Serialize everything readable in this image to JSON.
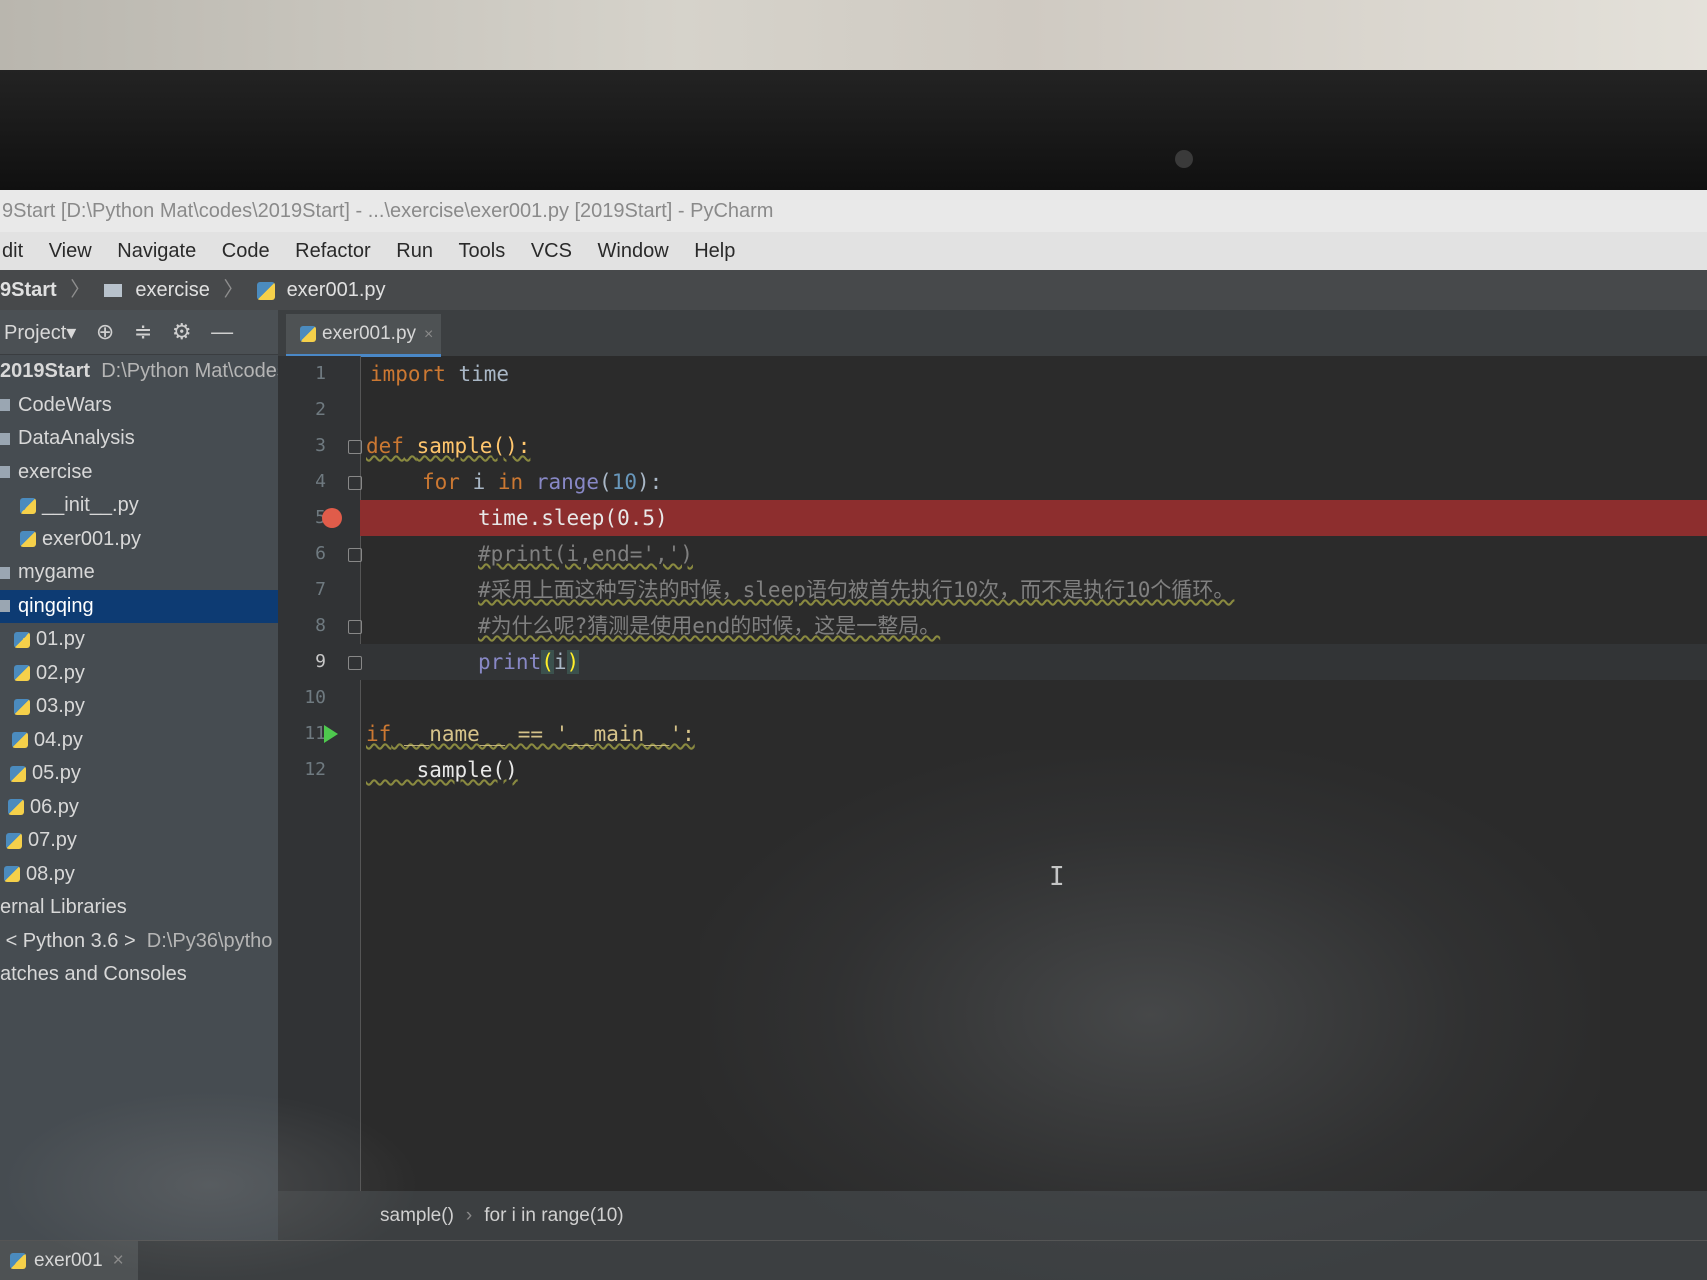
{
  "window": {
    "title": "9Start [D:\\Python Mat\\codes\\2019Start] - ...\\exercise\\exer001.py [2019Start] - PyCharm"
  },
  "menu": [
    "dit",
    "View",
    "Navigate",
    "Code",
    "Refactor",
    "Run",
    "Tools",
    "VCS",
    "Window",
    "Help"
  ],
  "navbar": {
    "project": "9Start",
    "folder": "exercise",
    "file": "exer001.py"
  },
  "project_panel": {
    "header": "Project▾",
    "items": [
      {
        "label": "2019Start",
        "extra": "D:\\Python Mat\\codes",
        "type": "root"
      },
      {
        "label": "CodeWars",
        "type": "folder"
      },
      {
        "label": "DataAnalysis",
        "type": "folder"
      },
      {
        "label": "exercise",
        "type": "folder"
      },
      {
        "label": "__init__.py",
        "type": "file"
      },
      {
        "label": "exer001.py",
        "type": "file"
      },
      {
        "label": "mygame",
        "type": "folder"
      },
      {
        "label": "qingqing",
        "type": "folder",
        "selected": true
      },
      {
        "label": "01.py",
        "type": "file"
      },
      {
        "label": "02.py",
        "type": "file"
      },
      {
        "label": "03.py",
        "type": "file"
      },
      {
        "label": "04.py",
        "type": "file"
      },
      {
        "label": "05.py",
        "type": "file"
      },
      {
        "label": "06.py",
        "type": "file"
      },
      {
        "label": "07.py",
        "type": "file"
      },
      {
        "label": "08.py",
        "type": "file"
      },
      {
        "label": "ernal Libraries",
        "type": "folder"
      },
      {
        "label": "< Python 3.6 >",
        "extra": "D:\\Py36\\pytho",
        "type": "sdk"
      },
      {
        "label": "atches and Consoles",
        "type": "folder"
      }
    ]
  },
  "editor": {
    "tab": "exer001.py",
    "line_numbers": [
      "1",
      "2",
      "3",
      "4",
      "5",
      "6",
      "7",
      "8",
      "9",
      "10",
      "11",
      "12"
    ],
    "lines": {
      "l1_kw": "import",
      "l1_rest": " time",
      "l3_kw": "def",
      "l3_fn": "sample",
      "l3_rest": "():",
      "l4_kw1": "for",
      "l4_i": " i ",
      "l4_kw2": "in",
      "l4_builtin": " range",
      "l4_open": "(",
      "l4_num": "10",
      "l4_close": "):",
      "l5_a": "time.sleep(",
      "l5_num": "0.5",
      "l5_b": ")",
      "l6_cmt": "#print(i,end=',')",
      "l7_cmt": "#采用上面这种写法的时候，sleep语句被首先执行10次，而不是执行10个循环。",
      "l8_cmt": "#为什么呢?猜测是使用end的时候，这是一整局。",
      "l9_builtin": "print",
      "l9_open": "(",
      "l9_arg": "i",
      "l9_close": ")",
      "l11_kw": "if",
      "l11_rest": " __name__ == '__main__':",
      "l12": "    sample()"
    },
    "breadcrumbs": [
      "sample()",
      "for i in range(10)"
    ]
  },
  "bottom": {
    "run_tab": "exer001"
  },
  "colors": {
    "breakpoint_line": "#8d2e2e",
    "selected_item": "#0d3b73",
    "keyword": "#cc7832",
    "number": "#6897bb",
    "function": "#ffc66d"
  }
}
